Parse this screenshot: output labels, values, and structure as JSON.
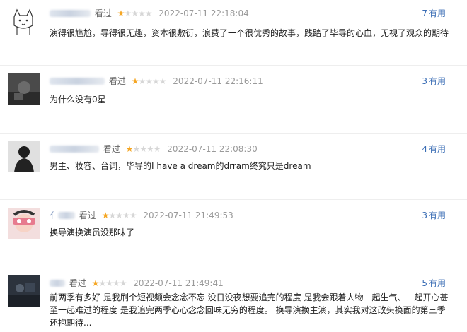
{
  "reviews": [
    {
      "username": "",
      "status": "看过",
      "rating": 1,
      "time": "2022-07-11 22:18:04",
      "useful_count": "7",
      "useful_label": "有用",
      "content": "演得很尴尬，导得很无趣，资本很敷衍，浪费了一个很优秀的故事，践踏了毕导的心血，无视了观众的期待"
    },
    {
      "username": "_M...",
      "status": "看过",
      "rating": 1,
      "time": "2022-07-11 22:16:11",
      "useful_count": "3",
      "useful_label": "有用",
      "content": "为什么没有0星"
    },
    {
      "username": "",
      "status": "看过",
      "rating": 1,
      "time": "2022-07-11 22:08:30",
      "useful_count": "4",
      "useful_label": "有用",
      "content": "男主、妆容、台词，毕导的I have a dream的drram终究只是dream"
    },
    {
      "username": "",
      "status": "看过",
      "rating": 1,
      "time": "2022-07-11 21:49:53",
      "useful_count": "3",
      "useful_label": "有用",
      "content": "换导演换演员没那味了"
    },
    {
      "username": "",
      "status": "看过",
      "rating": 1,
      "time": "2022-07-11 21:49:41",
      "useful_count": "5",
      "useful_label": "有用",
      "content": "前两季有多好 是我刷个短视频会念念不忘 没日没夜想要追完的程度 是我会跟着人物一起生气、一起开心甚至一起难过的程度 是我追完两季心心念念回味无穷的程度。 换导演换主演，其实我对这改头换面的第三季还抱期待..."
    }
  ],
  "avatar_icons": [
    "cat-doodle-avatar-icon",
    "dark-photo-avatar-icon",
    "person-silhouette-avatar-icon",
    "girl-face-avatar-icon",
    "dark-scene-avatar-icon"
  ]
}
